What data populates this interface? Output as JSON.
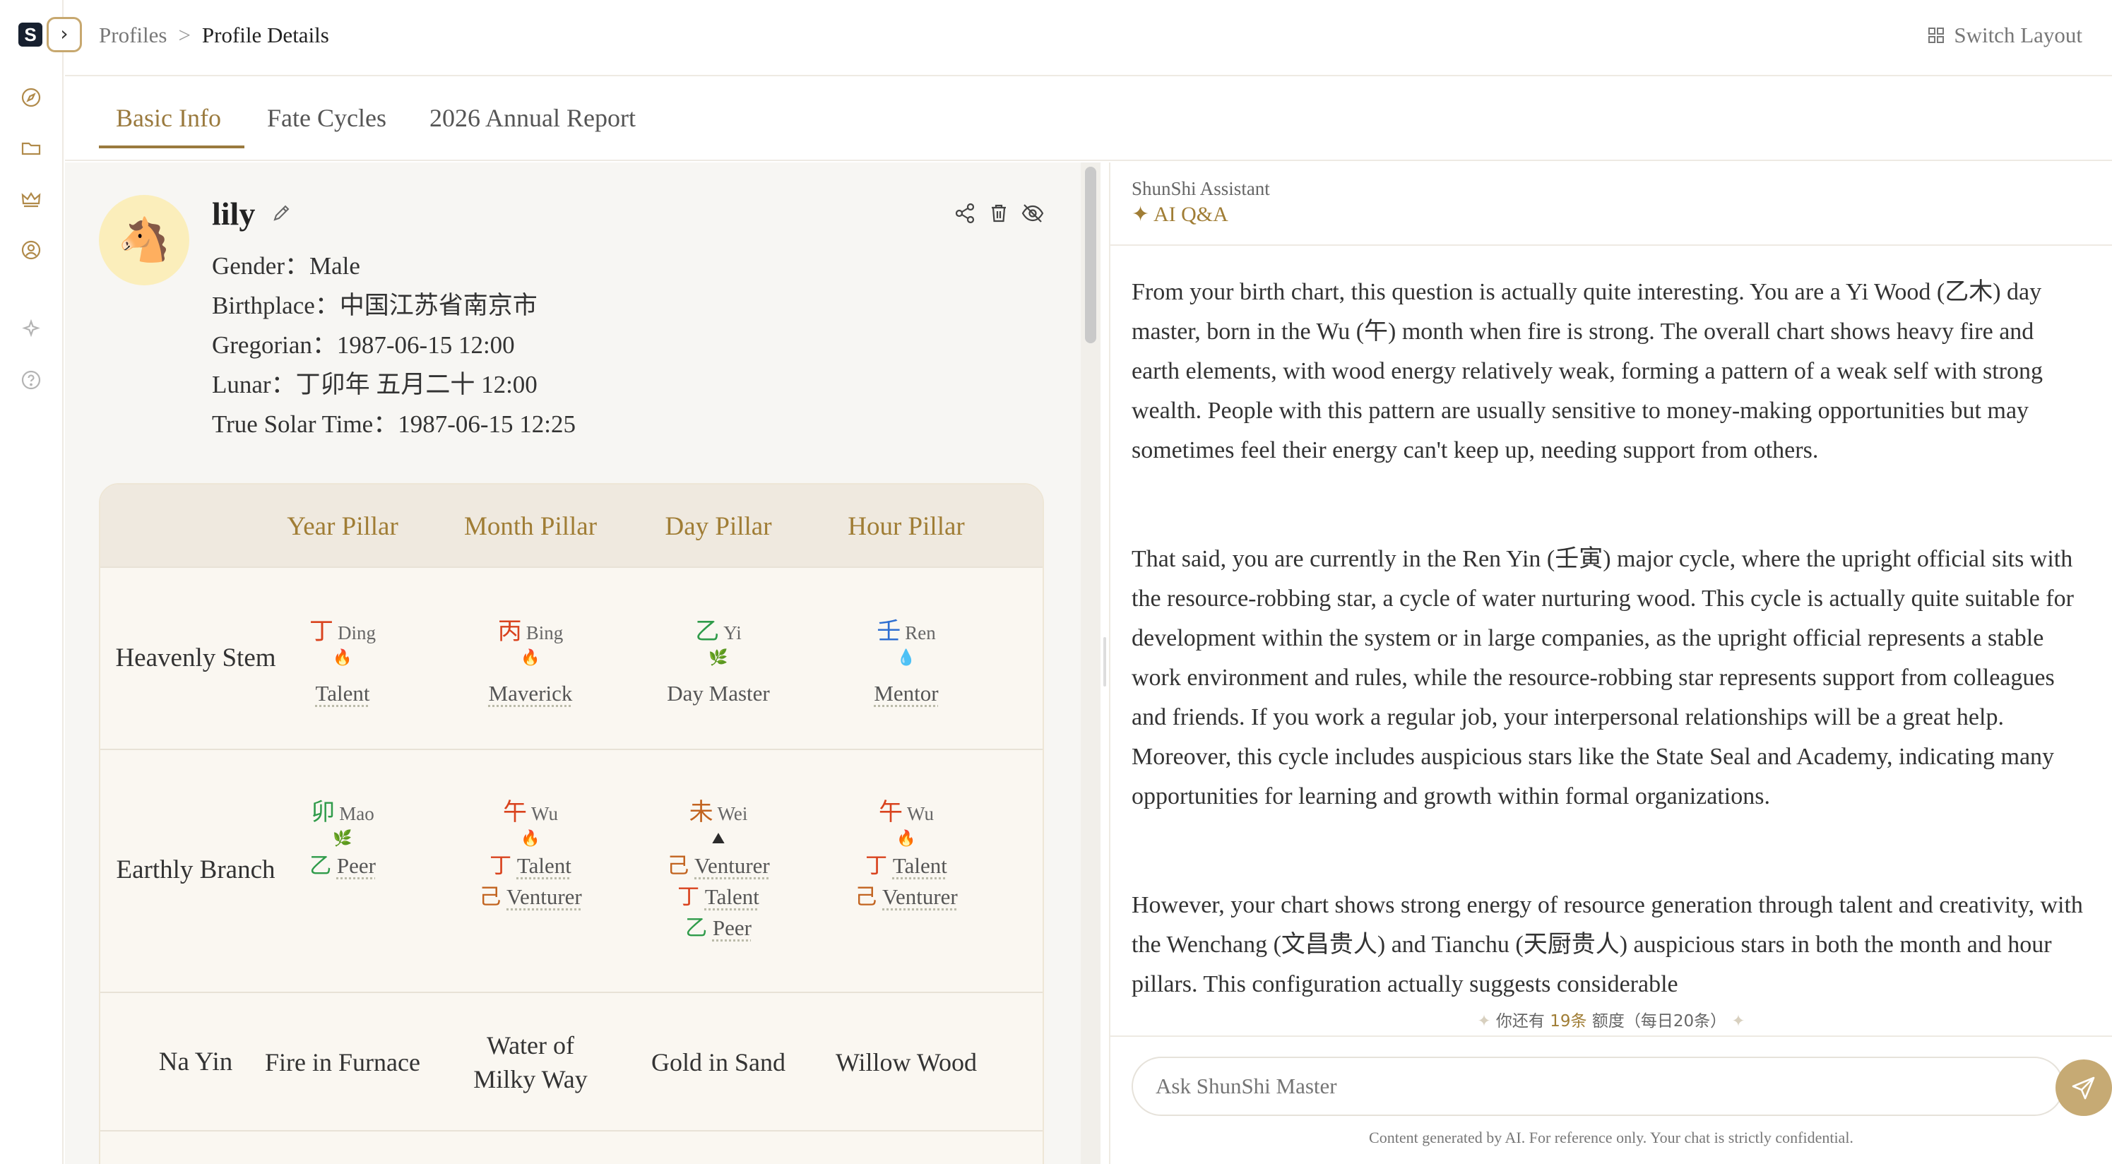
{
  "app": {
    "logo_text": "S"
  },
  "rail": {
    "icons": [
      "compass-icon",
      "folder-icon",
      "crown-icon",
      "user-circle-icon",
      "sparkle-icon",
      "help-icon"
    ]
  },
  "breadcrumb": {
    "parent": "Profiles",
    "separator": ">",
    "current": "Profile Details"
  },
  "header": {
    "switch_layout": "Switch Layout"
  },
  "tabs": [
    {
      "label": "Basic Info",
      "active": true
    },
    {
      "label": "Fate Cycles",
      "active": false
    },
    {
      "label": "2026 Annual Report",
      "active": false
    }
  ],
  "profile": {
    "name": "lily",
    "avatar": "🐴",
    "gender": "Gender：Male",
    "birthplace": "Birthplace：中国江苏省南京市",
    "gregorian": "Gregorian：1987-06-15 12:00",
    "lunar": "Lunar：丁卯年 五月二十 12:00",
    "true_solar": "True Solar Time：1987-06-15 12:25"
  },
  "pillars": {
    "headers": [
      "Year Pillar",
      "Month Pillar",
      "Day Pillar",
      "Hour Pillar"
    ],
    "row_labels": {
      "stem": "Heavenly Stem",
      "branch": "Earthly Branch",
      "nayin": "Na Yin"
    },
    "stems": [
      {
        "char": "丁",
        "pinyin": "Ding",
        "element": "fire",
        "icon": "🔥",
        "god": "Talent"
      },
      {
        "char": "丙",
        "pinyin": "Bing",
        "element": "fire",
        "icon": "🔥",
        "god": "Maverick"
      },
      {
        "char": "乙",
        "pinyin": "Yi",
        "element": "wood",
        "icon": "🌿",
        "god": "Day Master"
      },
      {
        "char": "壬",
        "pinyin": "Ren",
        "element": "water",
        "icon": "💧",
        "god": "Mentor"
      }
    ],
    "branches": [
      {
        "char": "卯",
        "pinyin": "Mao",
        "element": "wood",
        "icon": "🌿",
        "hidden": [
          {
            "char": "乙",
            "el": "wood",
            "god": "Peer"
          }
        ]
      },
      {
        "char": "午",
        "pinyin": "Wu",
        "element": "fire",
        "icon": "🔥",
        "hidden": [
          {
            "char": "丁",
            "el": "fire",
            "god": "Talent"
          },
          {
            "char": "己",
            "el": "earth",
            "god": "Venturer"
          }
        ]
      },
      {
        "char": "未",
        "pinyin": "Wei",
        "element": "earth",
        "icon": "⛰",
        "hidden": [
          {
            "char": "己",
            "el": "earth",
            "god": "Venturer"
          },
          {
            "char": "丁",
            "el": "fire",
            "god": "Talent"
          },
          {
            "char": "乙",
            "el": "wood",
            "god": "Peer"
          }
        ]
      },
      {
        "char": "午",
        "pinyin": "Wu",
        "element": "fire",
        "icon": "🔥",
        "hidden": [
          {
            "char": "丁",
            "el": "fire",
            "god": "Talent"
          },
          {
            "char": "己",
            "el": "earth",
            "god": "Venturer"
          }
        ]
      }
    ],
    "nayin": [
      "Fire in Furnace",
      "Water of Milky Way",
      "Gold in Sand",
      "Willow Wood"
    ]
  },
  "chat": {
    "assistant_name": "ShunShi Assistant",
    "mode": "AI Q&A",
    "paragraphs": [
      "From your birth chart, this question is actually quite interesting. You are a Yi Wood (乙木) day master, born in the Wu (午) month when fire is strong. The overall chart shows heavy fire and earth elements, with wood energy relatively weak, forming a pattern of a weak self with strong wealth. People with this pattern are usually sensitive to money-making opportunities but may sometimes feel their energy can't keep up, needing support from others.",
      "That said, you are currently in the Ren Yin (壬寅) major cycle, where the upright official sits with the resource-robbing star, a cycle of water nurturing wood. This cycle is actually quite suitable for development within the system or in large companies, as the upright official represents a stable work environment and rules, while the resource-robbing star represents support from colleagues and friends. If you work a regular job, your interpersonal relationships will be a great help. Moreover, this cycle includes auspicious stars like the State Seal and Academy, indicating many opportunities for learning and growth within formal organizations.",
      "However, your chart shows strong energy of resource generation through talent and creativity, with the Wenchang (文昌贵人) and Tianchu (天厨贵人) auspicious stars in both the month and hour pillars. This configuration actually suggests considerable"
    ],
    "quota_prefix": "你还有",
    "quota_count": "19条",
    "quota_suffix": "额度（每日20条）",
    "input_placeholder": "Ask ShunShi Master",
    "disclaimer": "Content generated by AI. For reference only. Your chat is strictly confidential."
  }
}
